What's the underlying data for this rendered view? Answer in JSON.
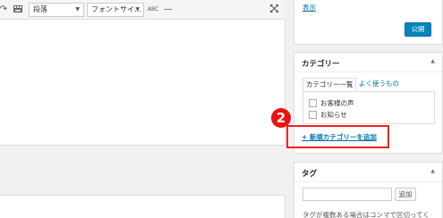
{
  "toolbar": {
    "paragraph_select": "段落",
    "font_select": "フォントサイ…",
    "icons": [
      "redo-icon",
      "keyboard-icon",
      "clear-formatting-icon",
      "horizontal-line-icon",
      "fullscreen-icon"
    ]
  },
  "publish": {
    "display_link": "表示",
    "publish_button": "公開"
  },
  "categories": {
    "title": "カテゴリー",
    "tabs": [
      "カテゴリー一覧",
      "よく使うもの"
    ],
    "items": [
      "お客様の声",
      "お知らせ"
    ],
    "add_link": "+ 新規カテゴリーを追加",
    "callout_number": "2"
  },
  "tags": {
    "title": "タグ",
    "add_button": "追加",
    "help_text": "タグが複数ある場合はコンマで区切ってく"
  },
  "colors": {
    "accent": "#0073aa",
    "primary_button": "#0085ba",
    "callout": "#ee1111"
  }
}
